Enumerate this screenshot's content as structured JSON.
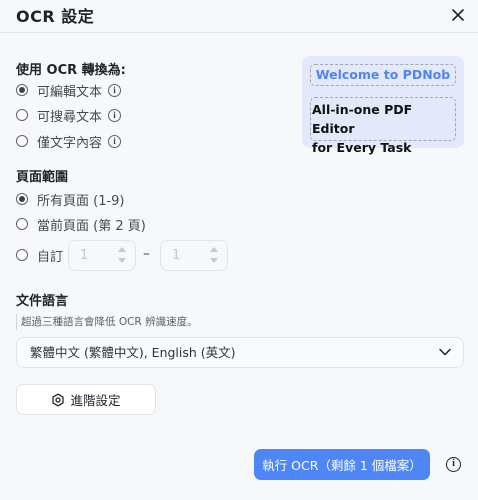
{
  "header": {
    "title": "OCR 設定"
  },
  "ocr_section": {
    "title": "使用 OCR 轉換為:",
    "options": [
      {
        "label": "可編輯文本",
        "checked": true
      },
      {
        "label": "可搜尋文本",
        "checked": false
      },
      {
        "label": "僅文字內容",
        "checked": false
      }
    ]
  },
  "promo": {
    "line1": "Welcome to PDNob",
    "line2": "All-in-one PDF Editor",
    "line3": "for Every Task"
  },
  "page_range": {
    "title": "頁面範圍",
    "options": [
      {
        "label": "所有頁面 (1-9)",
        "checked": true
      },
      {
        "label": "當前頁面 (第 2 頁)",
        "checked": false
      },
      {
        "label": "自訂",
        "checked": false
      }
    ],
    "from_value": "1",
    "dash": "–",
    "to_value": "1"
  },
  "language": {
    "title": "文件語言",
    "hint": "超過三種語言會降低 OCR 辨識速度。",
    "selected": "繁體中文 (繁體中文), English (英文)"
  },
  "advanced_button": "進階設定",
  "run_button": "執行 OCR（剩餘 1 個檔案）",
  "icons": {
    "close": "close-icon",
    "info": "info-icon",
    "chevron": "chevron-down-icon",
    "settings": "gear-icon"
  }
}
